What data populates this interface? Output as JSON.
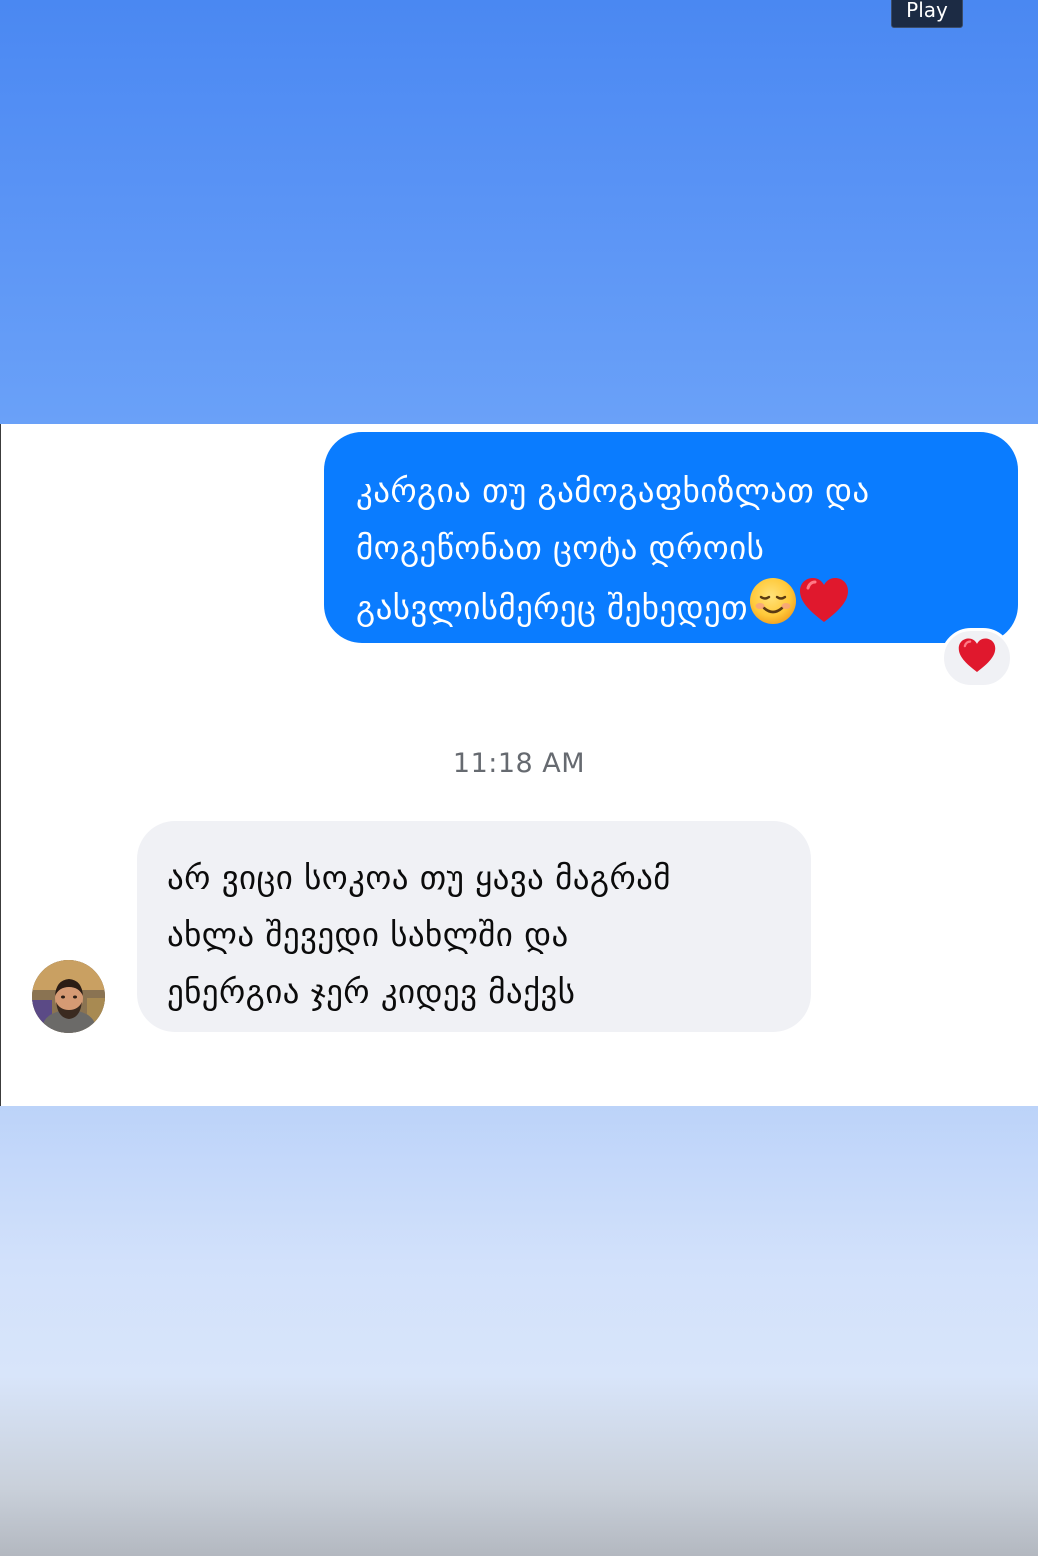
{
  "player": {
    "play_label": "Play"
  },
  "conversation": {
    "outgoing_message": {
      "lines": [
        "კარგია თუ გამოგაფხიზლათ და",
        "მოგეწონათ ცოტა დროის",
        "გასვლისმერეც შეხედეთ"
      ],
      "trailing_emojis": [
        "smiling-face-emoji",
        "red-heart-emoji"
      ],
      "reaction": "red-heart-emoji",
      "bubble_color": "#0a7cff"
    },
    "timestamp": "11:18 AM",
    "incoming_message": {
      "lines": [
        "არ ვიცი სოკოა თუ ყავა მაგრამ",
        "ახლა შევედი სახლში და",
        "ენერგია ჯერ კიდევ მაქვს"
      ],
      "bubble_color": "#f0f1f5",
      "sender_avatar": "avatar"
    }
  }
}
